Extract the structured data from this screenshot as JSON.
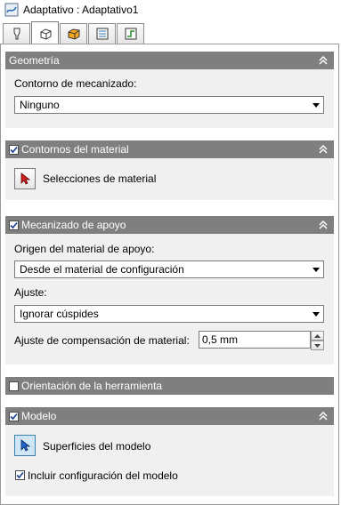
{
  "window": {
    "title": "Adaptativo : Adaptativo1"
  },
  "tabs": [
    {
      "icon": "tool-icon"
    },
    {
      "icon": "stock-box-icon",
      "active": true
    },
    {
      "icon": "box-icon"
    },
    {
      "icon": "list-icon"
    },
    {
      "icon": "linking-icon"
    }
  ],
  "geometria": {
    "title": "Geometría",
    "contorno_label": "Contorno de mecanizado:",
    "contorno_value": "Ninguno"
  },
  "contornos_material": {
    "title": "Contornos del material",
    "checked": true,
    "selections_label": "Selecciones de material"
  },
  "mecanizado_apoyo": {
    "title": "Mecanizado de apoyo",
    "checked": true,
    "origen_label": "Origen del material de apoyo:",
    "origen_value": "Desde el material de configuración",
    "ajuste_label": "Ajuste:",
    "ajuste_value": "Ignorar cúspides",
    "compensacion_label": "Ajuste de compensación de material:",
    "compensacion_value": "0,5 mm"
  },
  "orientacion": {
    "title": "Orientación de la herramienta",
    "checked": false
  },
  "modelo": {
    "title": "Modelo",
    "checked": true,
    "superficies_label": "Superficies del modelo",
    "incluir_label": "Incluir configuración del modelo",
    "incluir_checked": true
  },
  "colors": {
    "section_header": "#7f7f7f",
    "section_body": "#f0f0f0",
    "pick_active": "#cfe6f7"
  }
}
